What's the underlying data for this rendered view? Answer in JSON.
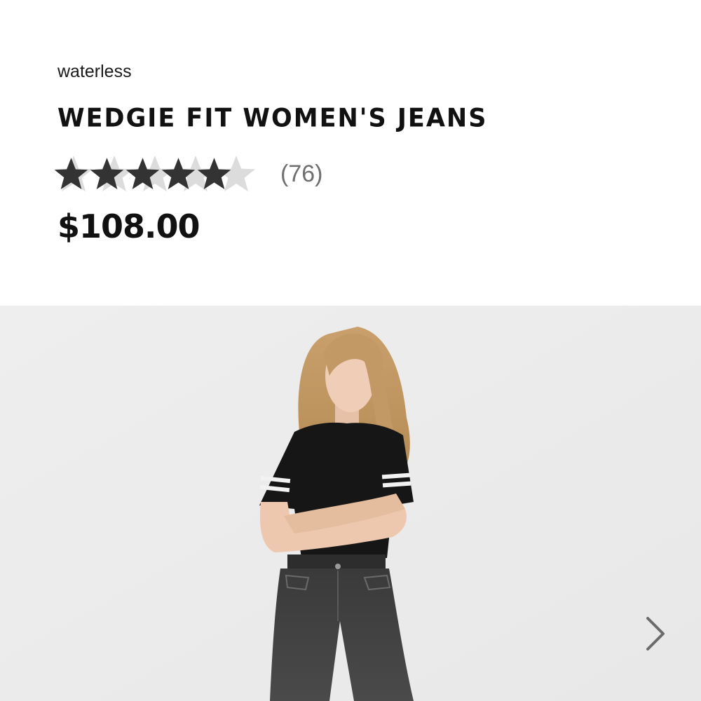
{
  "product": {
    "collection": "waterless",
    "title": "WEDGIE FIT WOMEN'S JEANS",
    "rating": 4.4,
    "rating_max": 5,
    "review_count": "(76)",
    "price": "$108.00"
  },
  "gallery": {
    "image_alt": "Model wearing black tee and washed black Wedgie Fit jeans",
    "next_icon": "chevron-right-icon"
  },
  "colors": {
    "star_filled": "#333333",
    "star_empty": "#dcdcdc",
    "review_count": "#6f6f6f",
    "hero_background": "#ededed"
  }
}
